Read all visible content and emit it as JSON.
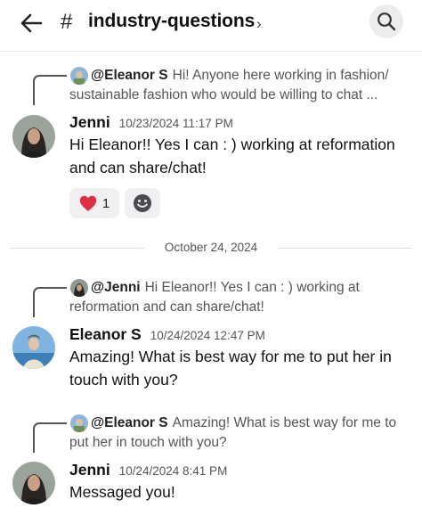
{
  "header": {
    "channel_hash": "#",
    "channel_name": "industry-questions",
    "chevron": "›",
    "icons": {
      "back": "arrow-left-icon",
      "search": "search-icon"
    }
  },
  "messages": [
    {
      "reply_mention": "@Eleanor S",
      "reply_text": "Hi! Anyone here working in fashion/ sustainable fashion who would be willing to chat ...",
      "author": "Jenni",
      "timestamp": "10/23/2024 11:17 PM",
      "content": "Hi Eleanor!! Yes I can : ) working at reformation and can share/chat!",
      "reactions": [
        {
          "emoji": "❤️",
          "count": "1"
        }
      ]
    },
    {
      "reply_mention": "@Jenni",
      "reply_text": "Hi Eleanor!! Yes I can : ) working at reformation and can share/chat!",
      "author": "Eleanor S",
      "timestamp": "10/24/2024 12:47 PM",
      "content": "Amazing! What is best way for me to put her in touch with you?"
    },
    {
      "reply_mention": "@Eleanor S",
      "reply_text": "Amazing! What is best way for me to put her in touch with you?",
      "author": "Jenni",
      "timestamp": "10/24/2024 8:41 PM",
      "content": "Messaged you!"
    }
  ],
  "date_separator": "October 24, 2024",
  "colors": {
    "text": "#111111",
    "muted": "#555555",
    "reaction_bg": "#f0f0f2",
    "heart": "#dd2e44"
  }
}
